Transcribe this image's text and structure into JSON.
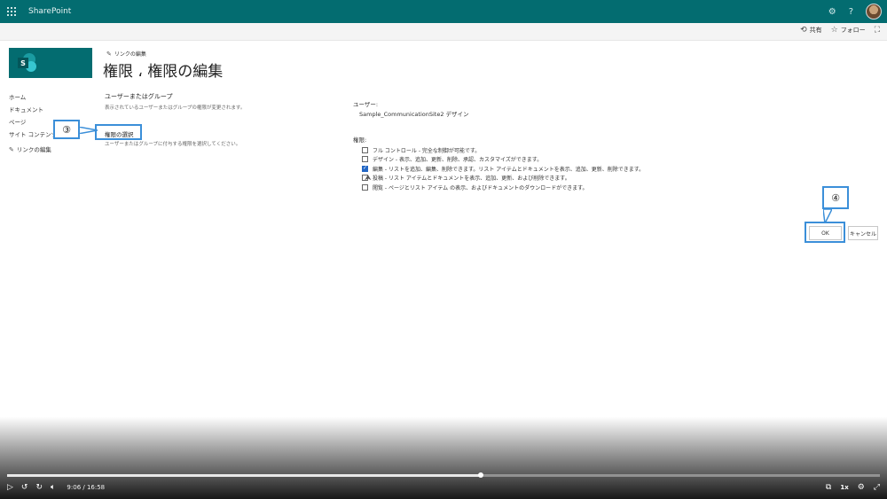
{
  "suitebar": {
    "app_name": "SharePoint",
    "settings_icon": "gear-icon",
    "help_icon": "question-icon"
  },
  "commandbar": {
    "share_label": "共有",
    "follow_label": "フォロー"
  },
  "header": {
    "edit_links_label": "リンクの編集",
    "page_title": "権限 ، 権限の編集"
  },
  "leftnav": {
    "items": [
      {
        "label": "ホーム"
      },
      {
        "label": "ドキュメント"
      },
      {
        "label": "ページ"
      },
      {
        "label": "サイト コンテンツ"
      }
    ],
    "edit_links_label": "リンクの編集"
  },
  "section": {
    "user_group_title": "ユーザーまたはグループ",
    "user_group_desc": "表示されているユーザーまたはグループの権限が変更されます。",
    "select_perm_title": "権限の選択",
    "select_perm_desc": "ユーザーまたはグループに付与する権限を選択してください。"
  },
  "form": {
    "user_label": "ユーザー:",
    "user_value": "Sample_CommunicationSite2 デザイン",
    "perm_label": "権限:",
    "permissions": [
      {
        "label": "フル コントロール - 完全な制御が可能です。",
        "checked": false
      },
      {
        "label": "デザイン - 表示、追加、更新、削除、承認、カスタマイズができます。",
        "checked": false
      },
      {
        "label": "編集 - リストを追加、編集、削除できます。リスト アイテムとドキュメントを表示、追加、更新、削除できます。",
        "checked": true
      },
      {
        "label": "投稿 - リスト アイテムとドキュメントを表示、追加、更新、および削除できます。",
        "checked": false
      },
      {
        "label": "閲覧 - ページとリスト アイテム の表示、およびドキュメントのダウンロードができます。",
        "checked": false
      }
    ],
    "ok_label": "OK",
    "cancel_label": "キャンセル"
  },
  "annotations": {
    "step3": "③",
    "step4": "④"
  },
  "video": {
    "time": "9:06 / 16:58",
    "progress": 0.543,
    "speed": "1x"
  },
  "colors": {
    "suitebar": "#036c70",
    "accent": "#2266c4",
    "annotation": "#3b8fd9"
  }
}
